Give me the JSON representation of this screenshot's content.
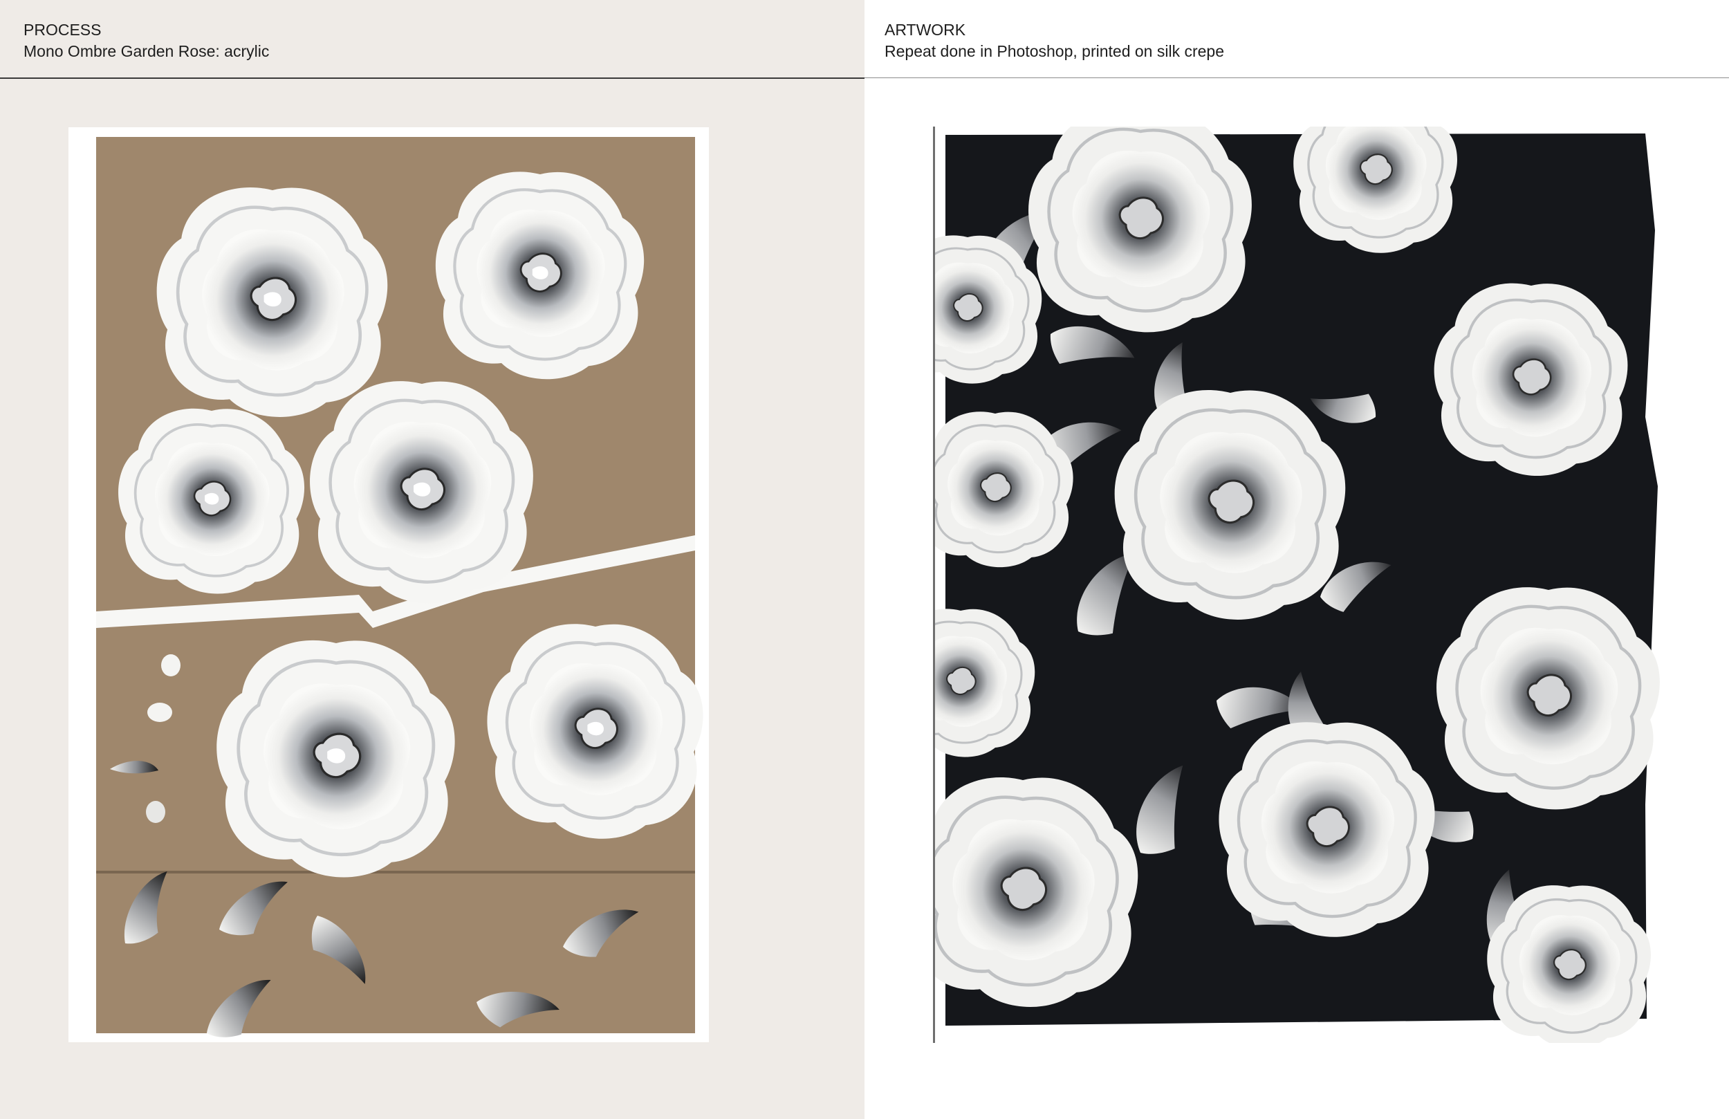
{
  "process": {
    "heading": "PROCESS",
    "subheading": "Mono Ombre Garden Rose: acrylic"
  },
  "artwork": {
    "heading": "ARTWORK",
    "subheading": "Repeat done in Photoshop, printed on silk crepe"
  },
  "images": {
    "process_photo": "painted roses and petals on cardboard",
    "artwork_photo": "black silk crepe printed with white roses"
  },
  "colors": {
    "left_panel_bg": "#efebe7",
    "right_panel_bg": "#ffffff",
    "cardboard": "#9f876c",
    "fabric": "#15171b",
    "paint_white": "#f4f4f2",
    "rule": "#3a3a3a"
  }
}
